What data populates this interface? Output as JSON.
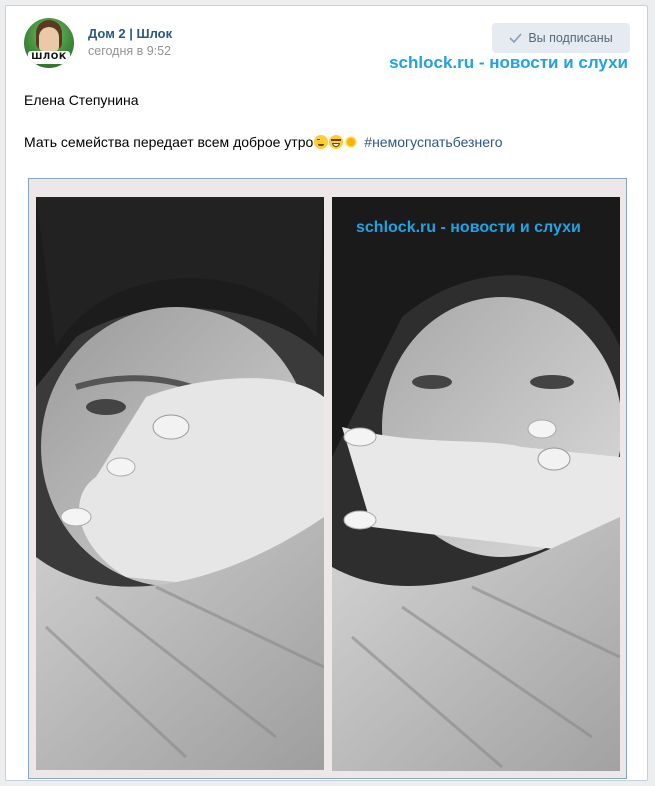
{
  "post": {
    "group_name": "Дом 2 | Шлок",
    "time": "сегодня в 9:52",
    "subscribe_button": "Вы подписаны",
    "watermark": "schlock.ru - новости и слухи",
    "avatar_logo": "ШЛОК",
    "author": "Елена Степунина",
    "caption": "Мать семейства передает всем доброе утро",
    "emojis": [
      "wink-emoji",
      "laughing-emoji",
      "sun-emoji"
    ],
    "hashtag": "#немогуспатьбезнего"
  },
  "photo": {
    "watermark": "schlock.ru - новости и слухи",
    "panels": [
      "left-selfie",
      "right-selfie"
    ]
  },
  "colors": {
    "link": "#2a5885",
    "watermark": "#1fa3e3",
    "button_bg": "#e5ebf1",
    "page_bg": "#edeef0"
  }
}
